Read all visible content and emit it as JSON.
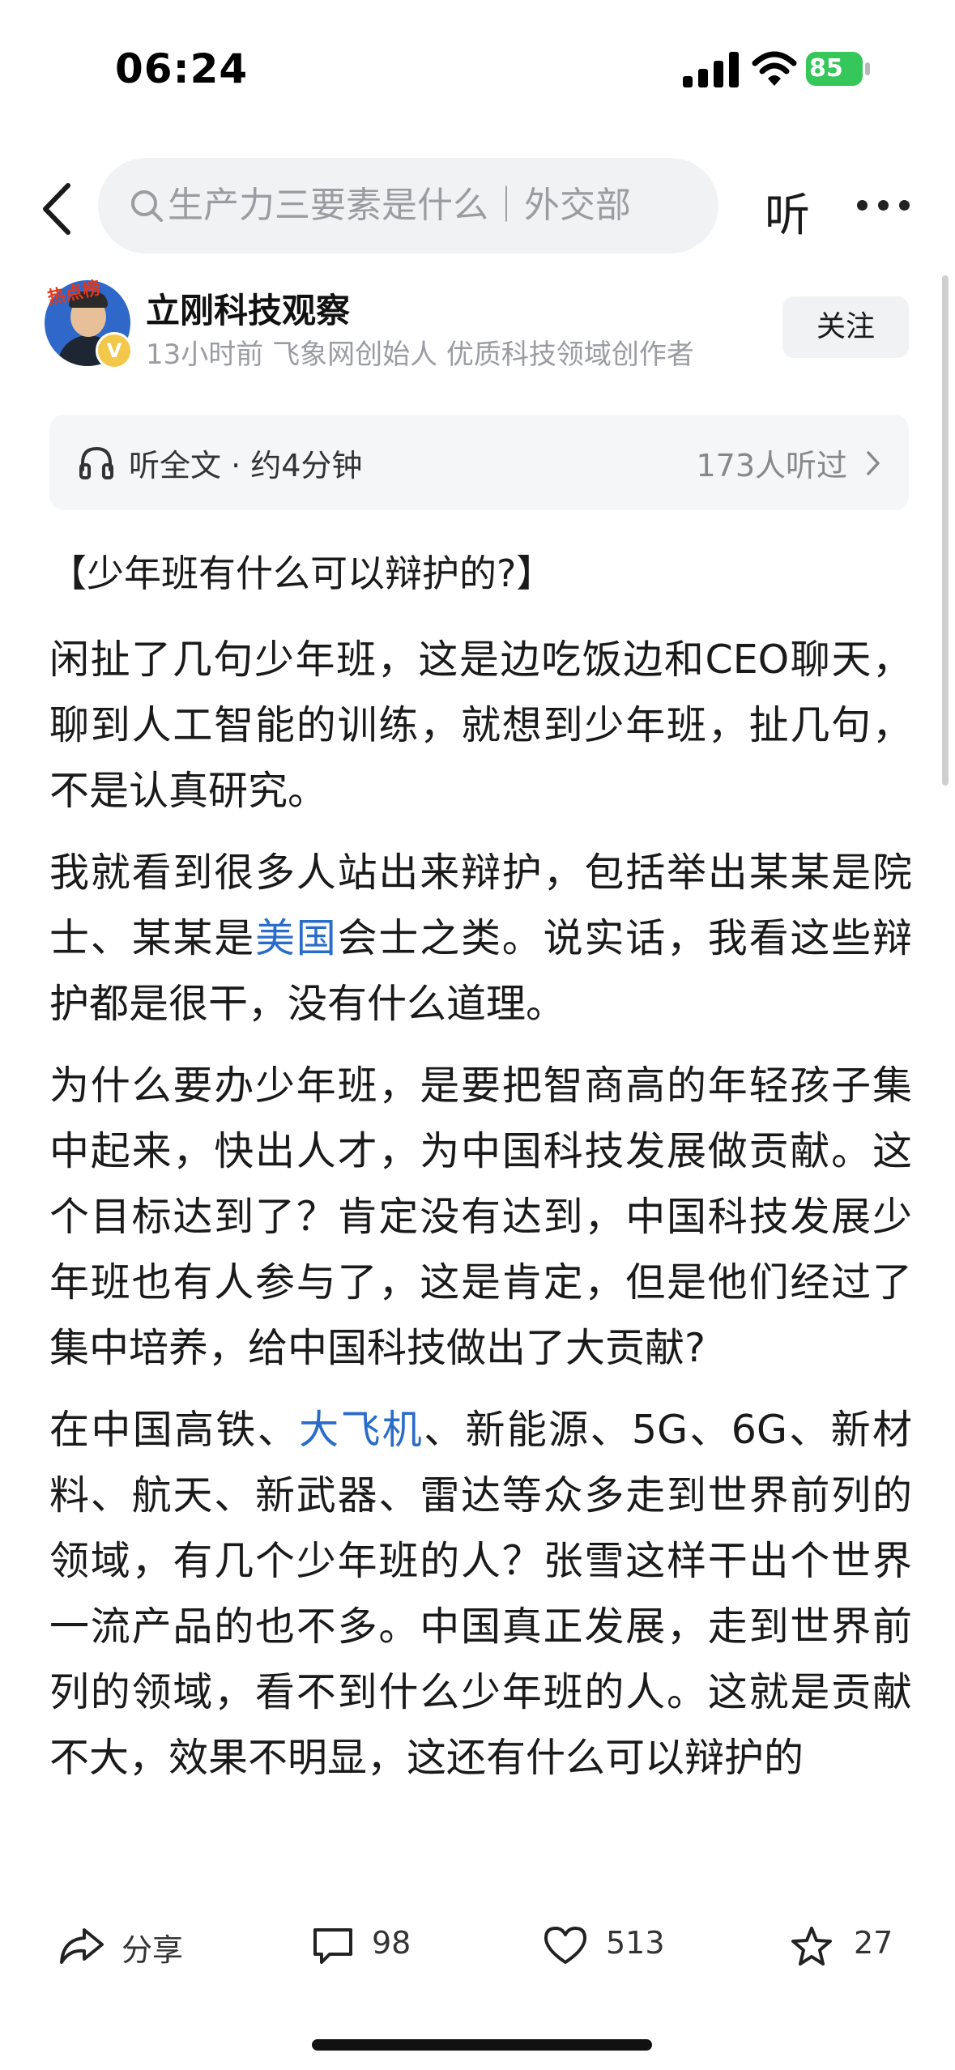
{
  "status_bar": {
    "time": "06:24",
    "battery": "85"
  },
  "nav": {
    "search_placeholder": "生产力三要素是什么｜外交部",
    "listen_label": "听"
  },
  "author": {
    "name": "立刚科技观察",
    "meta": "13小时前  飞象网创始人 优质科技领域创作者",
    "badge": "热点榜",
    "verified": "V",
    "follow_label": "关注"
  },
  "listen_bar": {
    "label": "听全文 · 约4分钟",
    "count": "173人听过"
  },
  "article": {
    "title": "【少年班有什么可以辩护的?】",
    "p1": "闲扯了几句少年班，这是边吃饭边和CEO聊天，聊到人工智能的训练，就想到少年班，扯几句，不是认真研究。",
    "p2_before": "我就看到很多人站出来辩护，包括举出某某是院士、某某是",
    "p2_link": "美国",
    "p2_after": "会士之类。说实话，我看这些辩护都是很干，没有什么道理。",
    "p3": "为什么要办少年班，是要把智商高的年轻孩子集中起来，快出人才，为中国科技发展做贡献。这个目标达到了？肯定没有达到，中国科技发展少年班也有人参与了，这是肯定，但是他们经过了集中培养，给中国科技做出了大贡献?",
    "p4_before": "在中国高铁、",
    "p4_link": "大飞机",
    "p4_after": "、新能源、5G、6G、新材料、航天、新武器、雷达等众多走到世界前列的领域，有几个少年班的人？张雪这样干出个世界一流产品的也不多。中国真正发展，走到世界前列的领域，看不到什么少年班的人。这就是贡献不大，效果不明显，这还有什么可以辩护的"
  },
  "actions": {
    "share": "分享",
    "comments": "98",
    "likes": "513",
    "favorites": "27"
  }
}
